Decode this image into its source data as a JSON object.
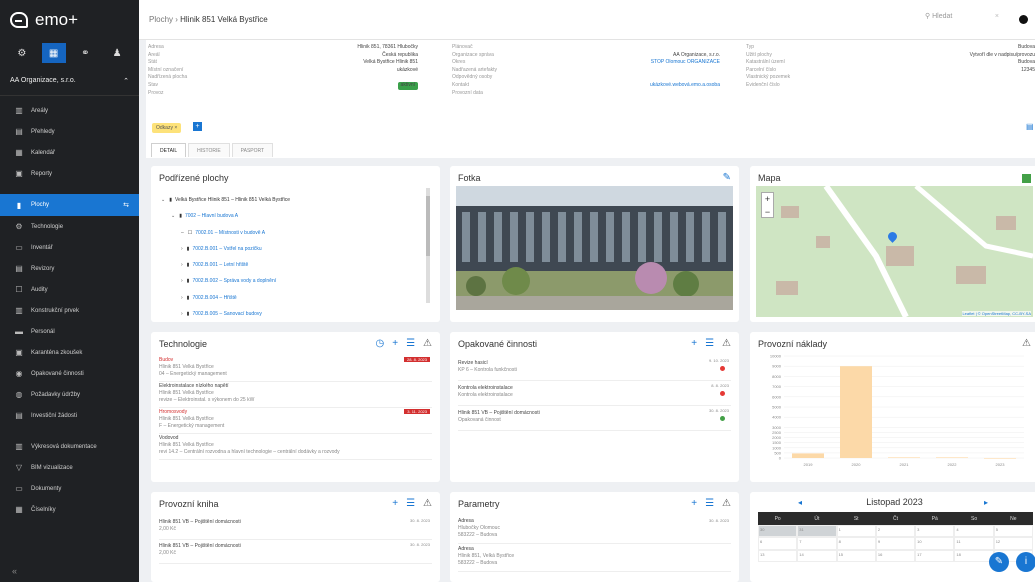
{
  "app": {
    "brand": "emo+"
  },
  "sidebar": {
    "tabs": [
      {
        "icon": "gear-icon",
        "g": "⚙"
      },
      {
        "icon": "building-icon",
        "g": "▦"
      },
      {
        "icon": "people-icon",
        "g": "⚭"
      },
      {
        "icon": "person-icon",
        "g": "♟"
      }
    ],
    "org": "AA Organizace, s.r.o.",
    "items": [
      {
        "label": "Areály",
        "icon": "▥"
      },
      {
        "label": "Přehledy",
        "icon": "▤"
      },
      {
        "label": "Kalendář",
        "icon": "▦"
      },
      {
        "label": "Reporty",
        "icon": "▣"
      },
      {
        "label": "Plochy",
        "icon": "▮"
      },
      {
        "label": "Technologie",
        "icon": "⚙"
      },
      {
        "label": "Inventář",
        "icon": "▭"
      },
      {
        "label": "Revizory",
        "icon": "▤"
      },
      {
        "label": "Audity",
        "icon": "☐"
      },
      {
        "label": "Konstrukční prvek",
        "icon": "▥"
      },
      {
        "label": "Personál",
        "icon": "▬"
      },
      {
        "label": "Karanténa zkoušek",
        "icon": "▣"
      },
      {
        "label": "Opakované činnosti",
        "icon": "◉"
      },
      {
        "label": "Požadavky údržby",
        "icon": "◍"
      },
      {
        "label": "Investiční žádosti",
        "icon": "▤"
      },
      {
        "label": "Výkresová dokumentace",
        "icon": "▥"
      },
      {
        "label": "BIM vizualizace",
        "icon": "▽"
      },
      {
        "label": "Dokumenty",
        "icon": "▭"
      },
      {
        "label": "Číselníky",
        "icon": "▦"
      }
    ],
    "collapse": "«"
  },
  "header": {
    "crumb_root": "Plochy",
    "crumb_sep": "›",
    "crumb_current": "Hlinik 851 Velká Bystřice",
    "search_placeholder": "Hledat",
    "search_clear": "×"
  },
  "info": {
    "c1": [
      [
        "Adresa",
        "Hlinik 851, 78361 Hlubočky"
      ],
      [
        "Areál",
        "Česká republika"
      ],
      [
        "Stát",
        "Velká Bystřice Hlinik 851"
      ],
      [
        "Místní označení",
        "ukázkové"
      ],
      [
        "Nadřízená plocha",
        ""
      ],
      [
        "Stav",
        "aktivní"
      ],
      [
        "Provoz",
        ""
      ]
    ],
    "c2": [
      [
        "Plánovač",
        ""
      ],
      [
        "Organizace správa",
        "AA Organizace, s.r.o."
      ],
      [
        "Okres",
        "STOP Olomouc ORGANIZACE"
      ],
      [
        "Nadřazená artefakty",
        ""
      ],
      [
        "Odpovědný osoby",
        ""
      ],
      [
        "Kontakt",
        "ukázkové.webová.emo.a.osoba"
      ],
      [
        "Provozní data",
        ""
      ]
    ],
    "c3": [
      [
        "Typ",
        "Budova"
      ],
      [
        "Užití plochy",
        "Vytvoří dle v nadpisu/provozu"
      ],
      [
        "Katastrální území",
        "Budova"
      ],
      [
        "Parcelní číslo",
        "12345"
      ],
      [
        "Vlastnický pozemek",
        ""
      ],
      [
        "Evidenční číslo",
        ""
      ]
    ],
    "tag": "Odkazy",
    "tag_x": "×",
    "tag_add": "+"
  },
  "tabs": [
    "DETAIL",
    "HISTORIE",
    "PASPORT"
  ],
  "tree": {
    "title": "Podřízené plochy",
    "nodes": [
      {
        "label": "Velká Bystřice Hlinik 851 – Hlinik 851 Velká Bystřice",
        "indent": 0,
        "arrow": "⌄",
        "icon": "▮"
      },
      {
        "label": "7002 – Hlavní budova A",
        "indent": 1,
        "arrow": "⌄",
        "icon": "▮"
      },
      {
        "label": "7002.01 – Místnosti v budově A",
        "indent": 2,
        "arrow": "–",
        "icon": "☐"
      },
      {
        "label": "7002.B.001 – Vstřel na pozičku",
        "indent": 2,
        "arrow": "›",
        "icon": "▮"
      },
      {
        "label": "7002.B.001 – Letní hřiště",
        "indent": 2,
        "arrow": "›",
        "icon": "▮"
      },
      {
        "label": "7002.B.002 – Správa vody a doplnění",
        "indent": 2,
        "arrow": "›",
        "icon": "▮"
      },
      {
        "label": "7002.B.004 – Hřiště",
        "indent": 2,
        "arrow": "›",
        "icon": "▮"
      },
      {
        "label": "7002.B.005 – Sanovací budovy",
        "indent": 2,
        "arrow": "›",
        "icon": "▮"
      }
    ]
  },
  "photo": {
    "title": "Fotka"
  },
  "map": {
    "title": "Mapa",
    "zoom_in": "+",
    "zoom_out": "−",
    "attribution": "Leaflet | © OpenStreetMap, CC-BY-SA"
  },
  "tech": {
    "title": "Technologie",
    "items": [
      {
        "t": "Budov",
        "red": true,
        "badge": "28. 8. 2023",
        "s1": "Hlinik 851 Velká Bystřice",
        "s2": "04 – Energetický management"
      },
      {
        "t": "Elektroinstalace nízkého napětí",
        "red": false,
        "badge": "",
        "s1": "Hlinik 851 Velká Bystřice",
        "s2": "revize – Elektroinstal. s výkonem do 25 kW"
      },
      {
        "t": "Hromosvody",
        "red": true,
        "badge": "3. 11. 2023",
        "s1": "Hlinik 851 Velká Bystřice",
        "s2": "F – Energetický management"
      },
      {
        "t": "Vodovod",
        "red": false,
        "badge": "",
        "s1": "Hlinik 851 Velká Bystřice",
        "s2": "revi 14.2 – Centrální rozvodna a hlavní technologie – centrální dodávky a rozvody"
      }
    ]
  },
  "rec": {
    "title": "Opakované činnosti",
    "items": [
      {
        "t": "Revize hasicí",
        "s": "KP 6 – Kontrola funkčnosti",
        "d": "9. 10. 2023",
        "c": "r"
      },
      {
        "t": "Kontrola elektroinstalace",
        "s": "Kontrola elektroinstalace",
        "d": "8. 8. 2023",
        "c": "r"
      },
      {
        "t": "Hlinik 851 VB – Pojištění domácnosti",
        "s": "Opakovaná činnost",
        "d": "30. 8. 2023",
        "c": "g"
      }
    ]
  },
  "costs": {
    "title": "Provozní náklady",
    "chart_data": {
      "type": "bar",
      "categories": [
        "2019",
        "2020",
        "2021",
        "2022",
        "2023"
      ],
      "values": [
        450,
        9000,
        60,
        60,
        0
      ],
      "yticks": [
        "10000",
        "9000",
        "8000",
        "7000",
        "6000",
        "5000",
        "4000",
        "3000",
        "2500",
        "2000",
        "1500",
        "1000",
        "500",
        "0"
      ],
      "ylim": [
        0,
        10000
      ],
      "title": "",
      "xlabel": "",
      "ylabel": ""
    }
  },
  "logbook": {
    "title": "Provozní kniha",
    "items": [
      {
        "t": "Hlinik 851 VB – Pojištění domácnosti",
        "s": "2,00 Kč",
        "d": "30. 8. 2023"
      },
      {
        "t": "Hlinik 851 VB – Pojištění domácnosti",
        "s": "2,00 Kč",
        "d": "30. 8. 2023"
      }
    ]
  },
  "params": {
    "title": "Parametry",
    "items": [
      {
        "t": "Adresa",
        "s1": "Hlubočky Olomouc",
        "s2": "583222 – Budova",
        "d": "30. 8. 2023"
      },
      {
        "t": "Adresa",
        "s1": "Hlinik 851, Velká Bystřice",
        "s2": "583222 – Budova",
        "d": ""
      }
    ]
  },
  "calendar": {
    "title": "Listopad 2023",
    "prev": "◂",
    "next": "▸",
    "days": [
      "Po",
      "Út",
      "St",
      "Čt",
      "Pá",
      "So",
      "Ne"
    ],
    "weeks": [
      [
        "30",
        "31",
        "1",
        "2",
        "3",
        "4",
        "5"
      ],
      [
        "6",
        "7",
        "8",
        "9",
        "10",
        "11",
        "12"
      ],
      [
        "13",
        "14",
        "15",
        "16",
        "17",
        "18",
        "19"
      ]
    ]
  },
  "fab": {
    "edit": "✎",
    "info": "i"
  },
  "colors": {
    "accent": "#1976d2",
    "sidebar": "#1f2124",
    "danger": "#d32f2f",
    "bar": "#fcd9a8"
  }
}
